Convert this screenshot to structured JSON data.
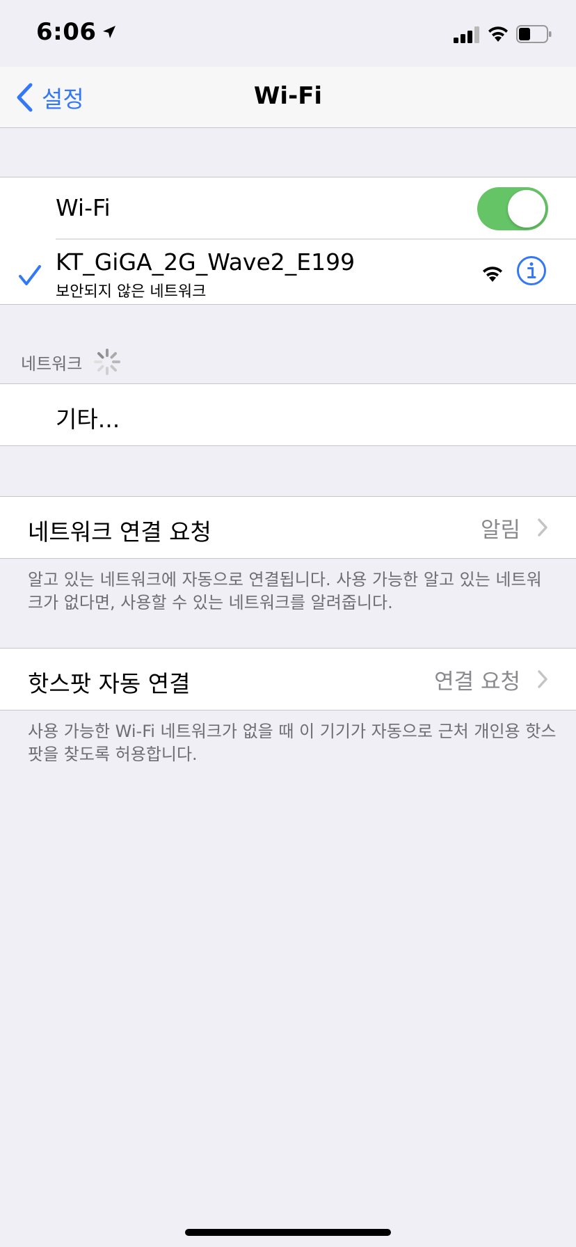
{
  "status_bar": {
    "time": "6:06",
    "icons": [
      "location-arrow-icon",
      "cellular-signal-icon",
      "wifi-icon",
      "battery-icon"
    ]
  },
  "nav": {
    "back_label": "설정",
    "title": "Wi-Fi"
  },
  "wifi_group": {
    "toggle_label": "Wi-Fi",
    "toggle_on": true,
    "connected_network": {
      "name": "KT_GiGA_2G_Wave2_E199",
      "subtitle": "보안되지 않은 네트워크"
    }
  },
  "networks_section": {
    "header": "네트워크",
    "other_label": "기타..."
  },
  "ask_to_join": {
    "label": "네트워크 연결 요청",
    "value": "알림",
    "footer": "알고 있는 네트워크에 자동으로 연결됩니다. 사용 가능한 알고 있는 네트워크가 없다면, 사용할 수 있는 네트워크를 알려줍니다."
  },
  "auto_join_hotspot": {
    "label": "핫스팟 자동 연결",
    "value": "연결 요청",
    "footer": "사용 가능한 Wi-Fi 네트워크가 없을 때 이 기기가 자동으로 근처 개인용 핫스팟을 찾도록 허용합니다."
  },
  "colors": {
    "accent": "#3478f6",
    "toggle_on": "#65c466",
    "background": "#f0eff5",
    "secondary_text": "#8a8a8e"
  }
}
